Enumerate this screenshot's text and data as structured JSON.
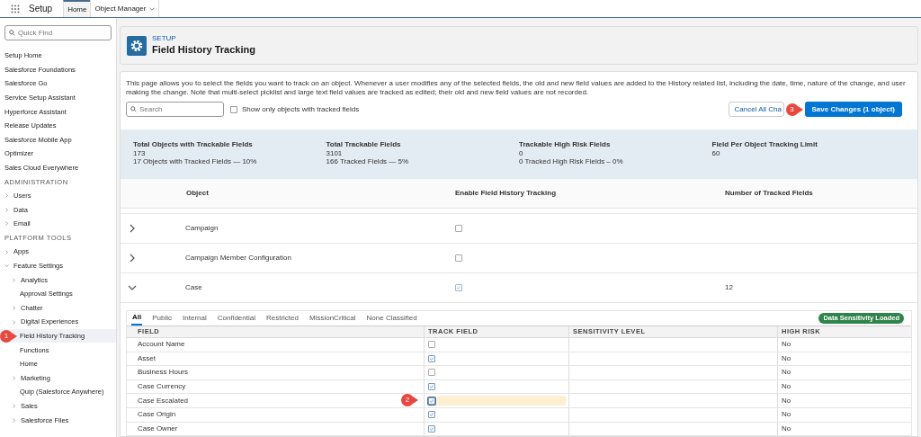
{
  "app": {
    "title": "Setup",
    "tabs": [
      {
        "label": "Home",
        "selected": true,
        "dropdown": false
      },
      {
        "label": "Object Manager",
        "selected": false,
        "dropdown": true
      }
    ]
  },
  "sidebar": {
    "search_placeholder": "Quick Find",
    "items": [
      {
        "kind": "link",
        "label": "Setup Home"
      },
      {
        "kind": "link",
        "label": "Salesforce Foundations"
      },
      {
        "kind": "link",
        "label": "Salesforce Go"
      },
      {
        "kind": "link",
        "label": "Service Setup Assistant"
      },
      {
        "kind": "link",
        "label": "Hyperforce Assistant"
      },
      {
        "kind": "link",
        "label": "Release Updates"
      },
      {
        "kind": "link",
        "label": "Salesforce Mobile App"
      },
      {
        "kind": "link",
        "label": "Optimizer"
      },
      {
        "kind": "link",
        "label": "Sales Cloud Everywhere"
      },
      {
        "kind": "heading",
        "label": "ADMINISTRATION"
      },
      {
        "kind": "node",
        "label": "Users",
        "expanded": false
      },
      {
        "kind": "node",
        "label": "Data",
        "expanded": false
      },
      {
        "kind": "node",
        "label": "Email",
        "expanded": false
      },
      {
        "kind": "heading",
        "label": "PLATFORM TOOLS"
      },
      {
        "kind": "node",
        "label": "Apps",
        "expanded": false
      },
      {
        "kind": "node",
        "label": "Feature Settings",
        "expanded": true,
        "children": [
          {
            "kind": "node",
            "label": "Analytics",
            "expanded": false
          },
          {
            "kind": "leaf",
            "label": "Approval Settings",
            "selected": false
          },
          {
            "kind": "node",
            "label": "Chatter",
            "expanded": false
          },
          {
            "kind": "node",
            "label": "Digital Experiences",
            "expanded": false
          },
          {
            "kind": "leaf",
            "label": "Field History Tracking",
            "selected": true,
            "callout": "1"
          },
          {
            "kind": "leaf",
            "label": "Functions",
            "selected": false
          },
          {
            "kind": "leaf",
            "label": "Home",
            "selected": false
          },
          {
            "kind": "node",
            "label": "Marketing",
            "expanded": false
          },
          {
            "kind": "leaf",
            "label": "Quip (Salesforce Anywhere)",
            "selected": false
          },
          {
            "kind": "node",
            "label": "Sales",
            "expanded": false
          },
          {
            "kind": "node",
            "label": "Salesforce Files",
            "expanded": false
          }
        ]
      }
    ]
  },
  "page_header": {
    "eyebrow": "SETUP",
    "title": "Field History Tracking"
  },
  "description": "This page allows you to select the fields you want to track on an object. Whenever a user modifies any of the selected fields, the old and new field values are added to the History related list, including the date, time, nature of the change, and user making the change. Note that multi-select picklist and large text field values are tracked as edited; their old and new field values are not recorded.",
  "toolbar": {
    "search_placeholder": "Search",
    "filter_label": "Show only objects with tracked fields",
    "filter_checked": false,
    "cancel_label": "Cancel All Cha",
    "save_label": "Save Changes (1 object)",
    "save_callout": "3"
  },
  "stats": [
    {
      "title": "Total Objects with Trackable Fields",
      "value": "173",
      "detail": "17 Objects with Tracked Fields — 10%"
    },
    {
      "title": "Total Trackable Fields",
      "value": "3101",
      "detail": "166 Tracked Fields — 5%"
    },
    {
      "title": "Trackable High Risk Fields",
      "value": "0",
      "detail": "0 Tracked High Risk Fields – 0%"
    },
    {
      "title": "Field Per Object Tracking Limit",
      "value": "60"
    }
  ],
  "objects": {
    "columns": [
      "Object",
      "Enable Field History Tracking",
      "Number of Tracked Fields"
    ],
    "rows": [
      {
        "name": "Campaign",
        "expanded": false,
        "enabled": false
      },
      {
        "name": "Campaign Member Configuration",
        "expanded": false,
        "enabled": false
      },
      {
        "name": "Case",
        "expanded": true,
        "enabled": true,
        "tracked_count": "12"
      }
    ]
  },
  "fields": {
    "tabs": [
      {
        "label": "All",
        "selected": true
      },
      {
        "label": "Public",
        "selected": false
      },
      {
        "label": "Internal",
        "selected": false
      },
      {
        "label": "Confidential",
        "selected": false
      },
      {
        "label": "Restricted",
        "selected": false
      },
      {
        "label": "MissionCritical",
        "selected": false
      },
      {
        "label": "None Classified",
        "selected": false
      }
    ],
    "badge": "Data Sensitivity Loaded",
    "columns": [
      "FIELD",
      "TRACK FIELD",
      "SENSITIVITY LEVEL",
      "HIGH RISK"
    ],
    "rows": [
      {
        "field": "Account Name",
        "tracked": false,
        "highlighted": false,
        "high_risk": "No"
      },
      {
        "field": "Asset",
        "tracked": true,
        "highlighted": false,
        "high_risk": "No"
      },
      {
        "field": "Business Hours",
        "tracked": false,
        "highlighted": false,
        "high_risk": "No"
      },
      {
        "field": "Case Currency",
        "tracked": true,
        "highlighted": false,
        "high_risk": "No"
      },
      {
        "field": "Case Escalated",
        "tracked": true,
        "highlighted": true,
        "high_risk": "No",
        "callout": "2"
      },
      {
        "field": "Case Origin",
        "tracked": true,
        "highlighted": false,
        "high_risk": "No"
      },
      {
        "field": "Case Owner",
        "tracked": true,
        "highlighted": false,
        "high_risk": "No"
      }
    ]
  }
}
